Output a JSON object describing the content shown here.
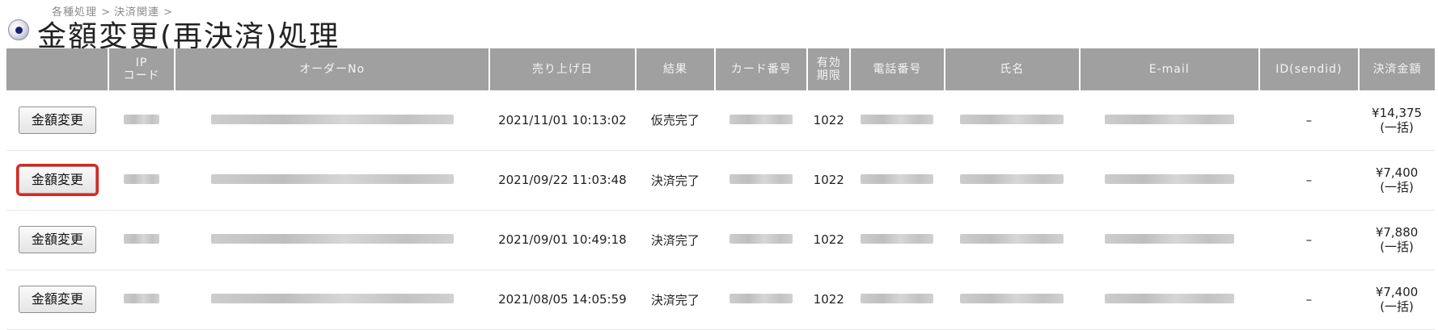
{
  "breadcrumb": [
    "各種処理 >",
    "決済関連 >"
  ],
  "page_title": "金額変更(再決済)処理",
  "columns": {
    "action": "",
    "ip_code_line1": "IP",
    "ip_code_line2": "コード",
    "order_no": "オーダーNo",
    "sale_date": "売り上げ日",
    "result": "結果",
    "card_no": "カード番号",
    "expiry_line1": "有効",
    "expiry_line2": "期限",
    "phone": "電話番号",
    "name": "氏名",
    "email": "E-mail",
    "id_sendid": "ID(sendid)",
    "amount": "決済金額"
  },
  "button_label": "金額変更",
  "rows": [
    {
      "sale_date": "2021/11/01 10:13:02",
      "result": "仮売完了",
      "expiry": "1022",
      "id_sendid": "–",
      "amount": "¥14,375",
      "payment_type": "(一括)",
      "highlighted": false
    },
    {
      "sale_date": "2021/09/22 11:03:48",
      "result": "決済完了",
      "expiry": "1022",
      "id_sendid": "–",
      "amount": "¥7,400",
      "payment_type": "(一括)",
      "highlighted": true
    },
    {
      "sale_date": "2021/09/01 10:49:18",
      "result": "決済完了",
      "expiry": "1022",
      "id_sendid": "–",
      "amount": "¥7,880",
      "payment_type": "(一括)",
      "highlighted": false
    },
    {
      "sale_date": "2021/08/05 14:05:59",
      "result": "決済完了",
      "expiry": "1022",
      "id_sendid": "–",
      "amount": "¥7,400",
      "payment_type": "(一括)",
      "highlighted": false
    }
  ],
  "colors": {
    "header_bg": "#a0a0a0",
    "highlight": "#e0241b"
  }
}
